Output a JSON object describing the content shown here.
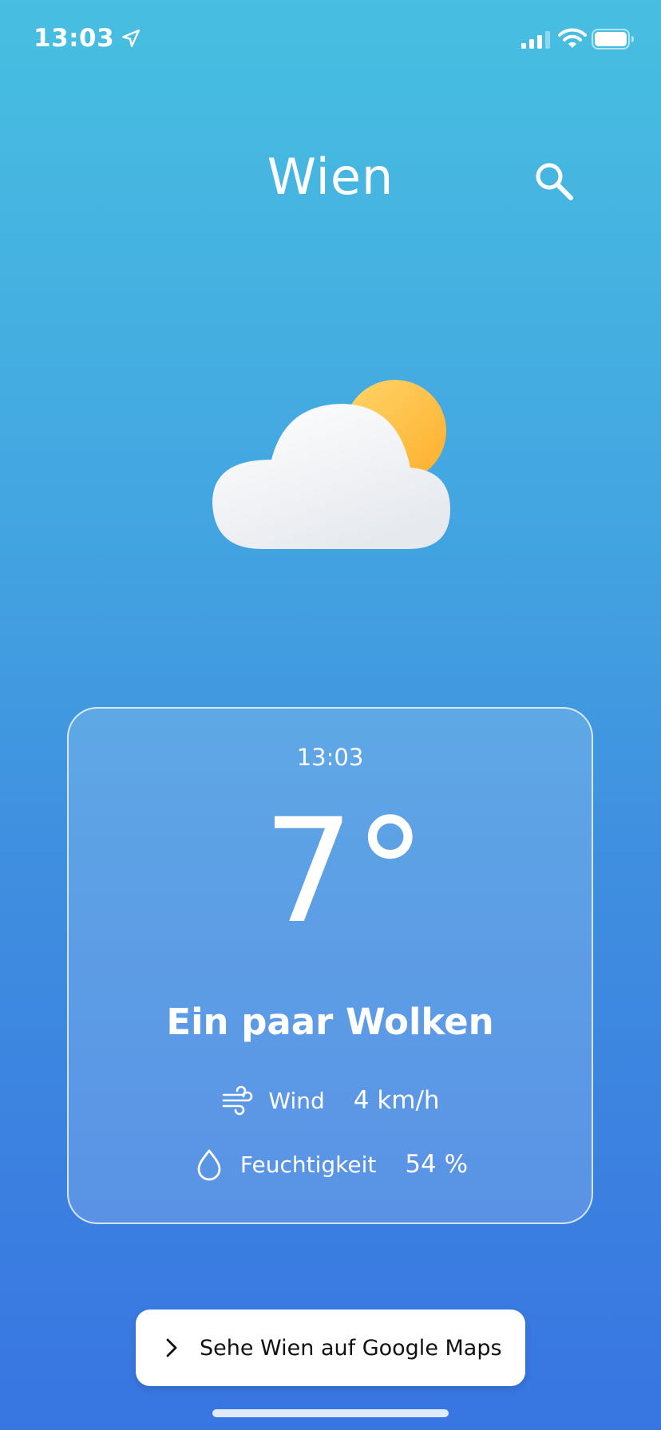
{
  "status_bar": {
    "time": "13:03",
    "icons": [
      "location-arrow-icon",
      "cellular-signal-icon",
      "wifi-icon",
      "battery-icon"
    ]
  },
  "header": {
    "city": "Wien",
    "search_icon": "search-icon"
  },
  "weather": {
    "icon": "partly-cloudy-icon",
    "time": "13:03",
    "temperature": "7°",
    "condition": "Ein paar Wolken",
    "wind": {
      "label": "Wind",
      "value": "4 km/h",
      "icon": "wind-icon"
    },
    "humidity": {
      "label": "Feuchtigkeit",
      "value": "54 %",
      "icon": "droplet-icon"
    }
  },
  "maps_button": {
    "label": "Sehe Wien auf Google Maps",
    "icon": "chevron-right-icon"
  },
  "colors": {
    "gradient_top": "#47bfe1",
    "gradient_bottom": "#3875e1",
    "sun": "#ffb935",
    "button_bg": "#ffffff"
  }
}
